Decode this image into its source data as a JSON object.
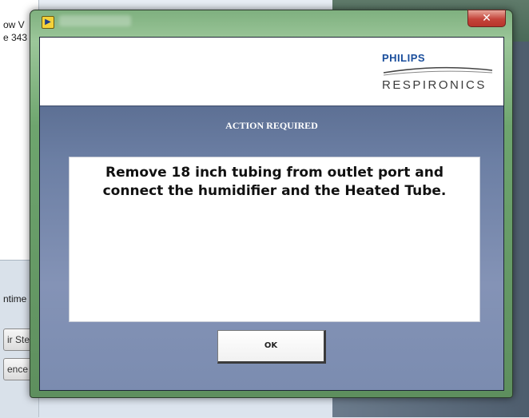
{
  "background": {
    "fragments": [
      "ow V",
      "e 343",
      "ntime",
      "ir Ste",
      "ence"
    ]
  },
  "dialog": {
    "title_icon": "labview-app-icon",
    "close_glyph": "✕"
  },
  "logo": {
    "brand_top": "PHILIPS",
    "brand_bottom": "RESPIRONICS"
  },
  "content": {
    "heading": "ACTION REQUIRED",
    "message": "Remove 18 inch tubing from outlet port and connect the humidifier and the Heated Tube.",
    "ok_label": "OK"
  },
  "colors": {
    "brand_blue": "#1a4e9c",
    "client_gradient_top": "#4a5d80",
    "client_gradient_bottom": "#7b8cb0",
    "frame_green": "#6ea56e",
    "close_red": "#c4443a"
  }
}
